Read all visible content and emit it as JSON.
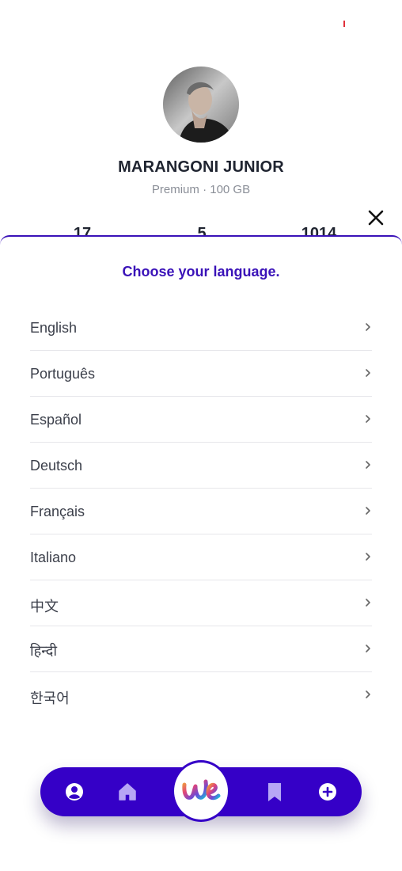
{
  "profile": {
    "name": "MARANGONI JUNIOR",
    "plan": "Premium · 100 GB",
    "stats": [
      "17",
      "5",
      "1014"
    ]
  },
  "sheet": {
    "title": "Choose your language.",
    "languages": [
      "English",
      "Português",
      "Español",
      "Deutsch",
      "Français",
      "Italiano",
      "中文",
      "हिन्दी",
      "한국어"
    ]
  },
  "icons": {
    "close": "close-icon",
    "chevron": "chevron-right-icon",
    "nav": [
      "user-circle-icon",
      "home-icon",
      "we-logo-icon",
      "bookmark-icon",
      "plus-circle-icon"
    ]
  },
  "colors": {
    "accent": "#3500c7",
    "title": "#3a12b8",
    "logo_gradient": [
      "#f0a23a",
      "#e0447a",
      "#6a4ad8",
      "#1fb7d6"
    ]
  }
}
